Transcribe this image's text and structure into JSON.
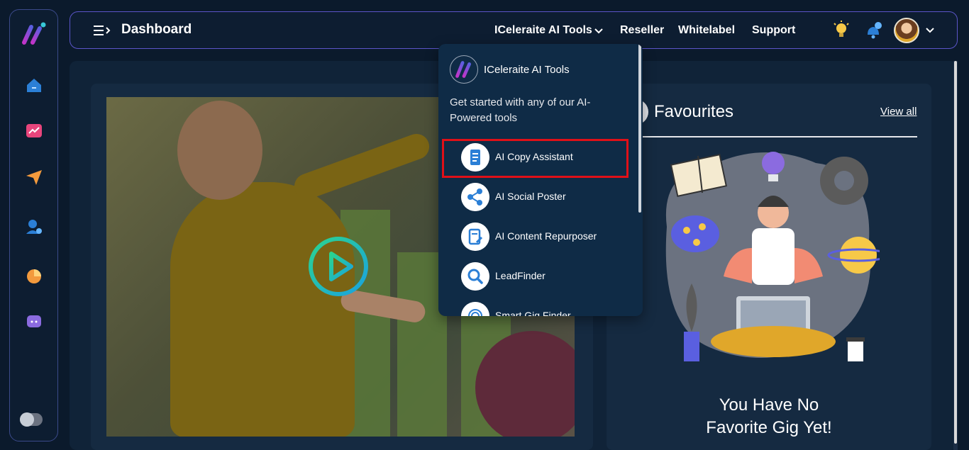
{
  "header": {
    "page_title": "Dashboard",
    "nav": {
      "tools": "ICeleraite AI Tools",
      "reseller": "Reseller",
      "whitelabel": "Whitelabel",
      "support": "Support"
    }
  },
  "dropdown": {
    "title": "ICeleraite AI Tools",
    "description": "Get started with any of our AI-Powered tools",
    "items": [
      {
        "label": "AI Copy Assistant",
        "icon": "document-icon"
      },
      {
        "label": "AI Social Poster",
        "icon": "share-icon"
      },
      {
        "label": "AI Content Repurposer",
        "icon": "edit-document-icon"
      },
      {
        "label": "LeadFinder",
        "icon": "search-icon"
      },
      {
        "label": "Smart Gig Finder",
        "icon": "fingerprint-icon"
      }
    ]
  },
  "favourites": {
    "title": "Favourites",
    "view_all": "View all",
    "empty_line1": "You Have No",
    "empty_line2": "Favorite Gig Yet!"
  },
  "colors": {
    "background": "#0b1a2c",
    "panel": "#152a41",
    "accent": "#5b55c9",
    "highlight": "#e01018",
    "icon_blue": "#2b7fd6"
  }
}
